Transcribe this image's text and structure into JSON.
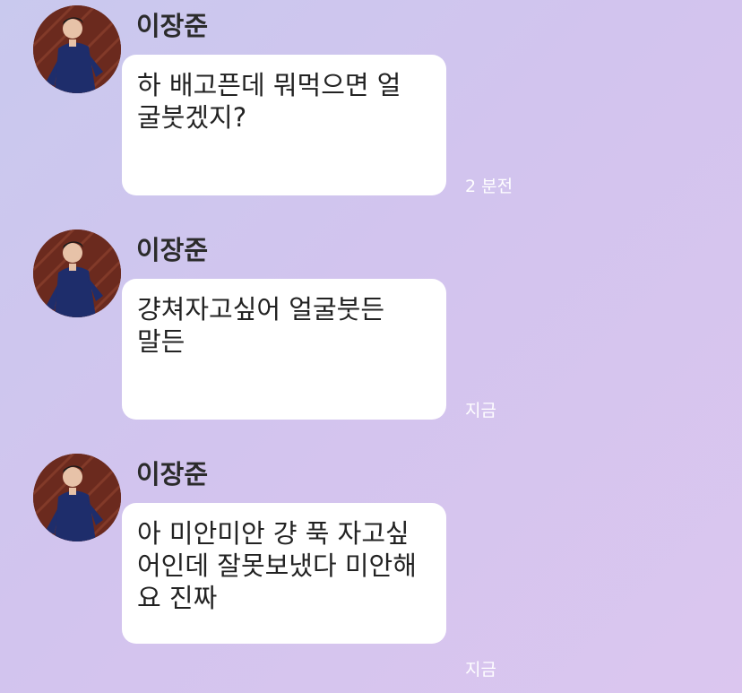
{
  "colors": {
    "bubble": "#ffffff",
    "sender_name": "#2b2b2b",
    "message_text": "#222222",
    "timestamp": "#ffffff"
  },
  "messages": [
    {
      "sender": "이장준",
      "text": "하 배고픈데 뭐먹으면 얼\n굴붓겠지?",
      "time": "2 분전"
    },
    {
      "sender": "이장준",
      "text": "걍쳐자고싶어 얼굴붓든\n말든",
      "time": "지금"
    },
    {
      "sender": "이장준",
      "text": "아 미안미안 걍 푹 자고싶\n어인데 잘못보냈다 미안해\n요 진짜",
      "time": "지금"
    }
  ]
}
